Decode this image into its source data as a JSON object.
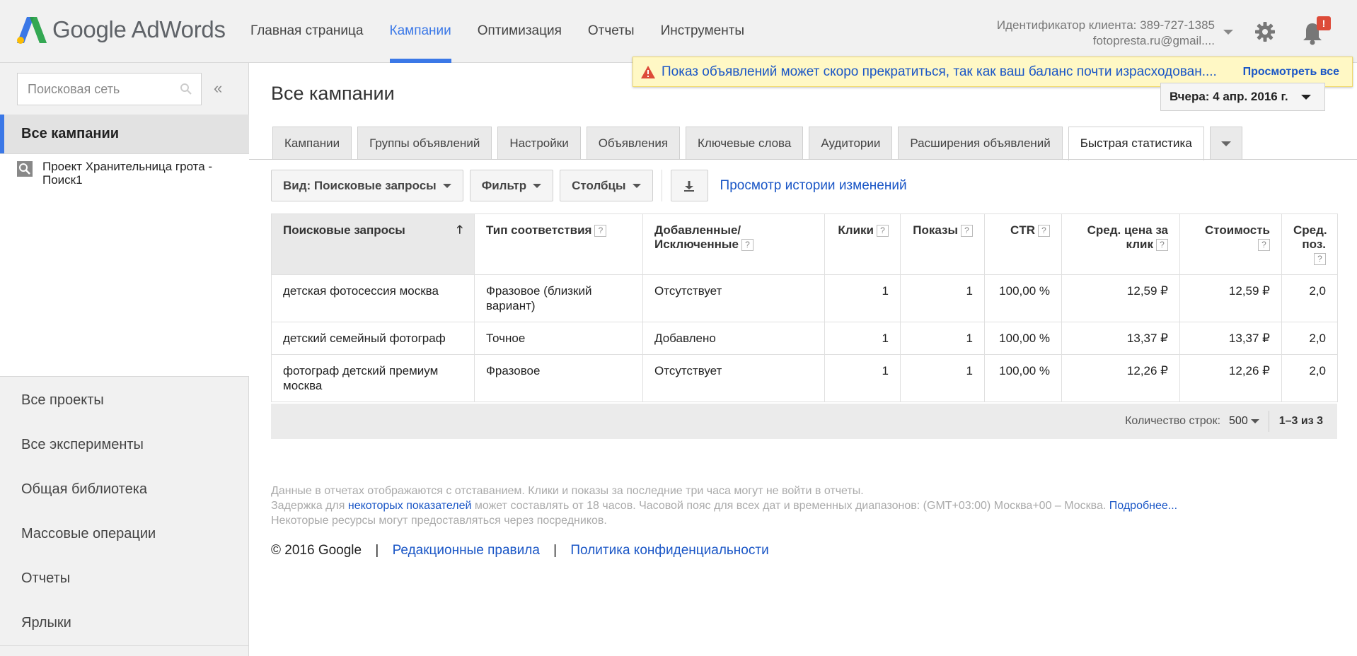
{
  "header": {
    "logo_text": "Google AdWords",
    "nav": [
      "Главная страница",
      "Кампании",
      "Оптимизация",
      "Отчеты",
      "Инструменты"
    ],
    "account_id": "Идентификатор клиента: 389-727-1385",
    "account_email": "fotopresta.ru@gmail....",
    "notification_badge": "!"
  },
  "warning": {
    "text": "Показ объявлений может скоро прекратиться, так как ваш баланс почти израсходован....",
    "link": "Просмотреть все"
  },
  "sidebar": {
    "search_placeholder": "Поисковая сеть",
    "collapse": "«",
    "all_campaigns": "Все кампании",
    "campaign": "Проект Хранительница грота - Поиск1",
    "menu": [
      "Все проекты",
      "Все эксперименты",
      "Общая библиотека",
      "Массовые операции",
      "Отчеты",
      "Ярлыки"
    ]
  },
  "main": {
    "title": "Все кампании",
    "date_range": "Вчера: 4 апр. 2016 г.",
    "tabs": [
      "Кампании",
      "Группы объявлений",
      "Настройки",
      "Объявления",
      "Ключевые слова",
      "Аудитории",
      "Расширения объявлений",
      "Быстрая статистика"
    ],
    "active_tab": "Быстрая статистика",
    "toolbar": {
      "view": "Вид: Поисковые запросы",
      "filter": "Фильтр",
      "columns": "Столбцы",
      "history": "Просмотр истории изменений"
    }
  },
  "table": {
    "headers": [
      "Поисковые запросы",
      "Тип соответствия",
      "Добавленные/ Исключенные",
      "Клики",
      "Показы",
      "CTR",
      "Сред. цена за клик",
      "Стоимость",
      "Сред. поз."
    ],
    "rows": [
      [
        "детская фотосессия москва",
        "Фразовое (близкий вариант)",
        "Отсутствует",
        "1",
        "1",
        "100,00 %",
        "12,59 ₽",
        "12,59 ₽",
        "2,0"
      ],
      [
        "детский семейный фотограф",
        "Точное",
        "Добавлено",
        "1",
        "1",
        "100,00 %",
        "13,37 ₽",
        "13,37 ₽",
        "2,0"
      ],
      [
        "фотограф детский премиум москва",
        "Фразовое",
        "Отсутствует",
        "1",
        "1",
        "100,00 %",
        "12,26 ₽",
        "12,26 ₽",
        "2,0"
      ]
    ]
  },
  "pager": {
    "rows_label": "Количество строк:",
    "rows_value": "500",
    "range": "1–3 из 3"
  },
  "notes": {
    "line1": "Данные в отчетах отображаются с отставанием. Клики и показы за последние три часа могут не войти в отчеты.",
    "line2_pre": "Задержка для ",
    "line2_link": "некоторых показателей",
    "line2_post": " может составлять от 18 часов. Часовой пояс для всех дат и временных диапазонов: (GMT+03:00) Москва+00 – Москва. ",
    "line2_more": "Подробнее...",
    "line3": "Некоторые ресурсы могут предоставляться через посредников."
  },
  "footer": {
    "copyright": "© 2016 Google",
    "sep": "|",
    "editorial": "Редакционные правила",
    "privacy": "Политика конфиденциальности"
  },
  "colors": {
    "accent": "#3b78e7",
    "link": "#1a56c6",
    "warning_bg": "#fff8c5",
    "alert": "#dd4b39"
  }
}
